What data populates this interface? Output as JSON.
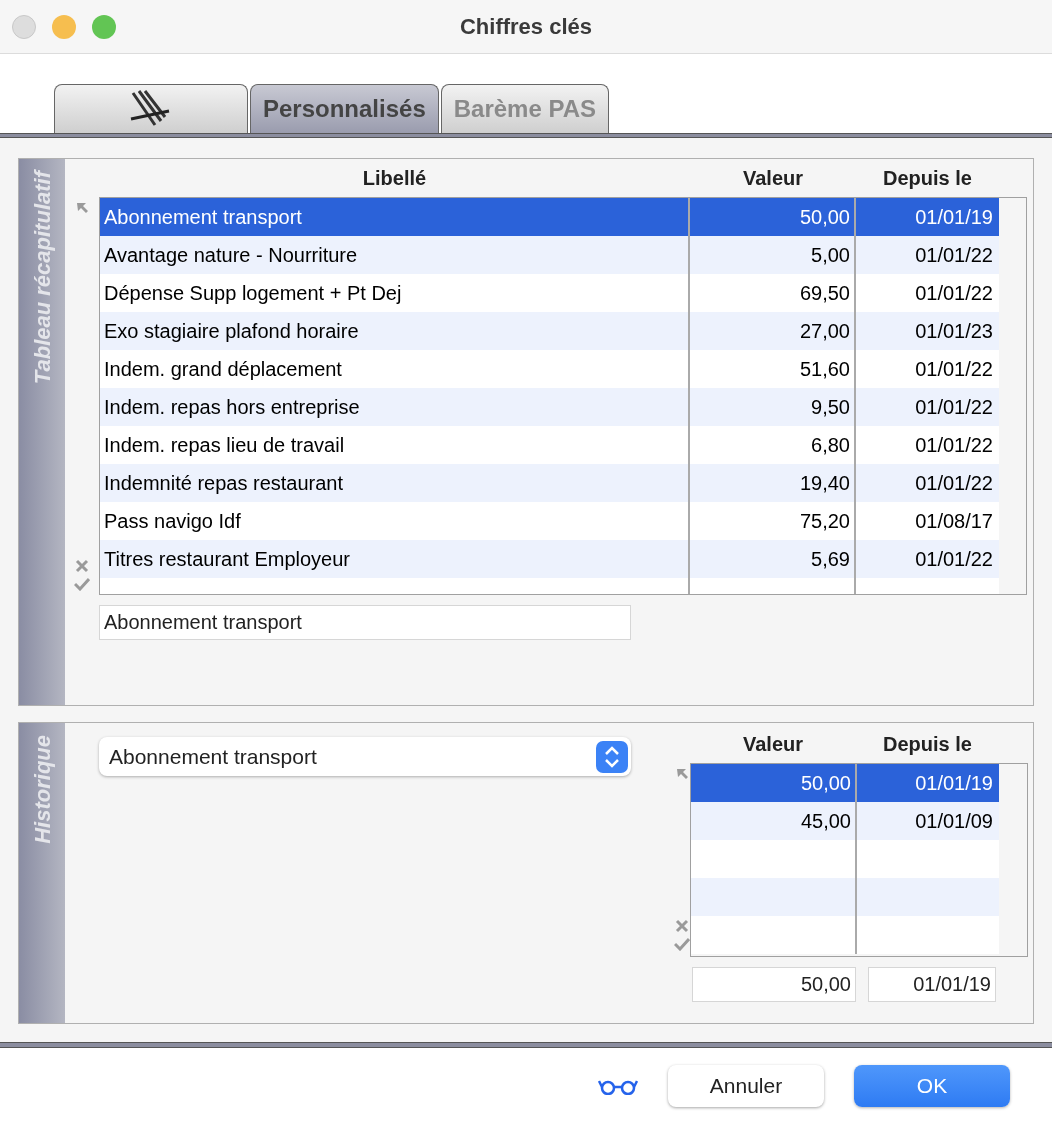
{
  "window": {
    "title": "Chiffres clés"
  },
  "tabs": [
    {
      "kind": "icon",
      "selected": false
    },
    {
      "kind": "text",
      "label": "Personnalisés",
      "selected": true
    },
    {
      "kind": "text",
      "label": "Barème PAS",
      "selected": false
    }
  ],
  "summary": {
    "side_label": "Tableau récapitulatif",
    "columns": [
      "Libellé",
      "Valeur",
      "Depuis le"
    ],
    "rows": [
      {
        "label": "Abonnement transport",
        "value": "50,00",
        "since": "01/01/19",
        "selected": true
      },
      {
        "label": "Avantage nature - Nourriture",
        "value": "5,00",
        "since": "01/01/22",
        "selected": false
      },
      {
        "label": "Dépense Supp logement + Pt Dej",
        "value": "69,50",
        "since": "01/01/22",
        "selected": false
      },
      {
        "label": "Exo stagiaire plafond horaire",
        "value": "27,00",
        "since": "01/01/23",
        "selected": false
      },
      {
        "label": "Indem. grand déplacement",
        "value": "51,60",
        "since": "01/01/22",
        "selected": false
      },
      {
        "label": "Indem. repas hors entreprise",
        "value": "9,50",
        "since": "01/01/22",
        "selected": false
      },
      {
        "label": "Indem. repas lieu de travail",
        "value": "6,80",
        "since": "01/01/22",
        "selected": false
      },
      {
        "label": "Indemnité repas restaurant",
        "value": "19,40",
        "since": "01/01/22",
        "selected": false
      },
      {
        "label": "Pass navigo Idf",
        "value": "75,20",
        "since": "01/08/17",
        "selected": false
      },
      {
        "label": "Titres restaurant Employeur",
        "value": "5,69",
        "since": "01/01/22",
        "selected": false
      }
    ],
    "edit_value": "Abonnement transport"
  },
  "history": {
    "side_label": "Historique",
    "select_value": "Abonnement transport",
    "columns": [
      "Valeur",
      "Depuis le"
    ],
    "rows": [
      {
        "value": "50,00",
        "since": "01/01/19",
        "selected": true
      },
      {
        "value": "45,00",
        "since": "01/01/09",
        "selected": false
      }
    ],
    "edit_value": "50,00",
    "edit_since": "01/01/19"
  },
  "buttons": {
    "cancel": "Annuler",
    "ok": "OK"
  }
}
